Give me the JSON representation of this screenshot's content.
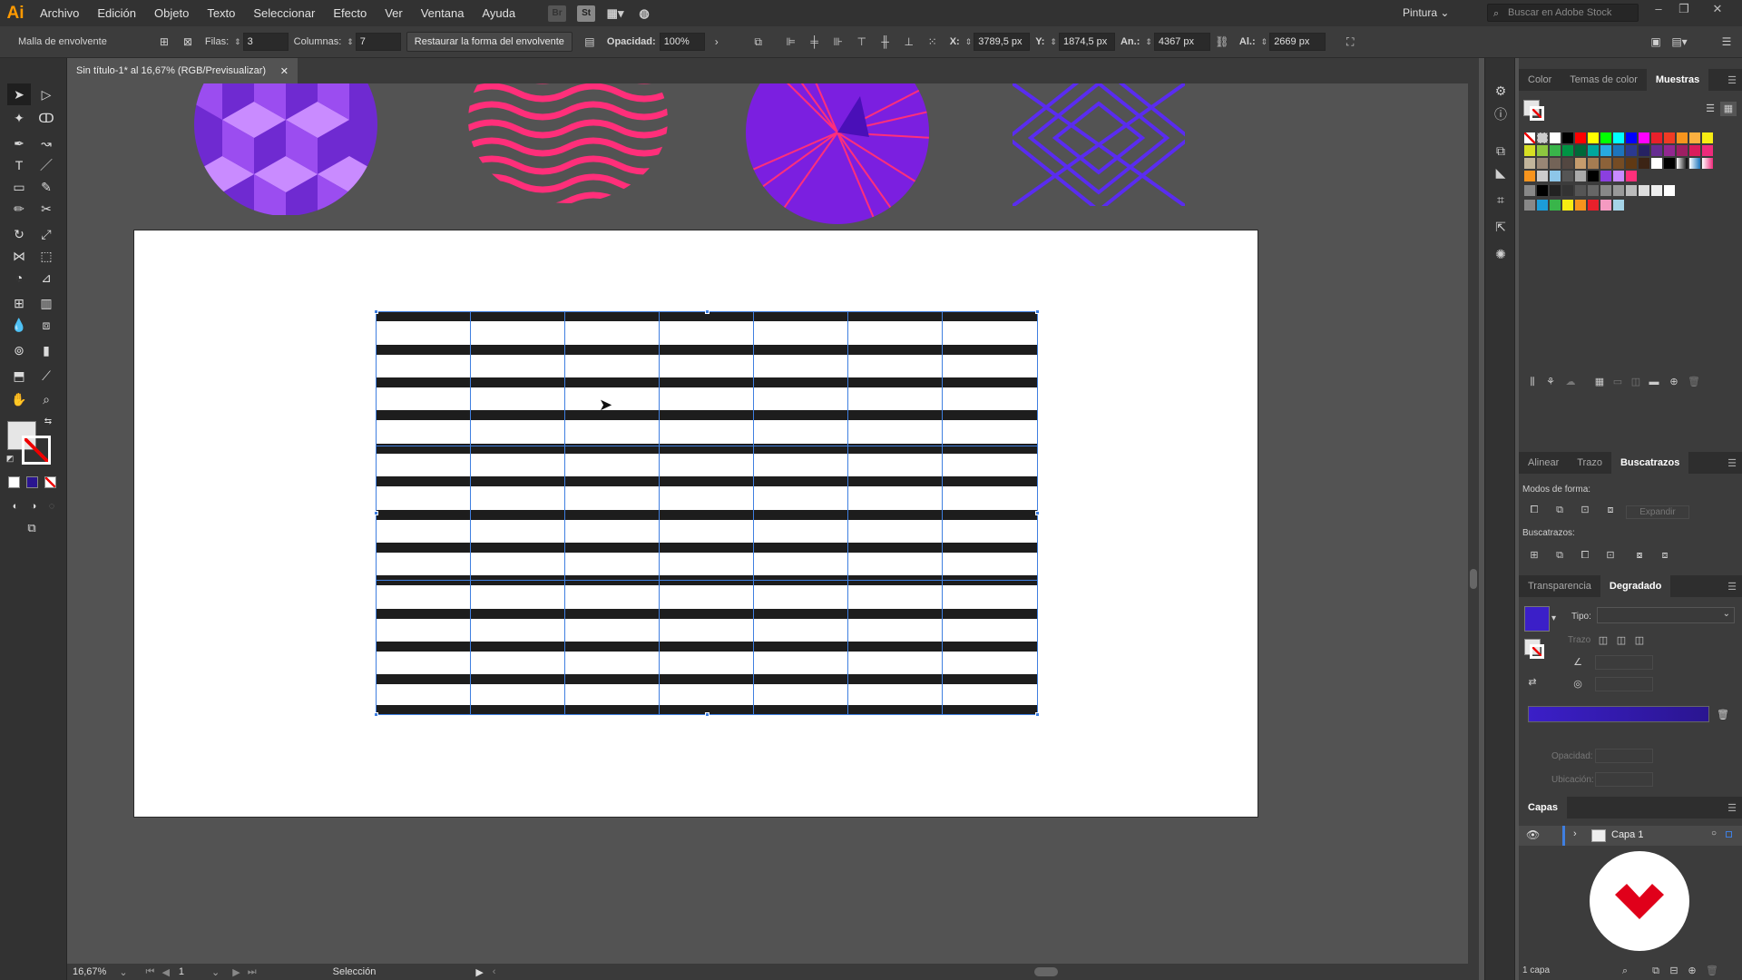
{
  "app": {
    "logo": "Ai",
    "workspace": "Pintura",
    "stock_placeholder": "Buscar en Adobe Stock"
  },
  "menus": [
    "Archivo",
    "Edición",
    "Objeto",
    "Texto",
    "Seleccionar",
    "Efecto",
    "Ver",
    "Ventana",
    "Ayuda"
  ],
  "control": {
    "object_type": "Malla de envolvente",
    "rows_label": "Filas:",
    "rows_value": "3",
    "cols_label": "Columnas:",
    "cols_value": "7",
    "restore_label": "Restaurar la forma del envolvente",
    "opacity_label": "Opacidad:",
    "opacity_value": "100%",
    "x_label": "X:",
    "x_value": "3789,5 px",
    "y_label": "Y:",
    "y_value": "1874,5 px",
    "w_label": "An.:",
    "w_value": "4367 px",
    "h_label": "Al.:",
    "h_value": "2669 px"
  },
  "document": {
    "tab_title": "Sin título-1* al 16,67% (RGB/Previsualizar)"
  },
  "status": {
    "zoom": "16,67%",
    "page": "1",
    "tool": "Selección"
  },
  "panels": {
    "top_tabs": [
      "Color",
      "Temas de color",
      "Muestras"
    ],
    "mid_tabs": [
      "Alinear",
      "Trazo",
      "Buscatrazos"
    ],
    "shape_modes": "Modos de forma:",
    "expand": "Expandir",
    "pathfinders": "Buscatrazos:",
    "grad_tabs": [
      "Transparencia",
      "Degradado"
    ],
    "type_label": "Tipo:",
    "stroke_label": "Trazo",
    "opacity_label": "Opacidad:",
    "location_label": "Ubicación:",
    "layers_tab": "Capas",
    "layer_name": "Capa 1",
    "layers_count": "1 capa"
  },
  "colors": {
    "accent_selection": "#3f7fe0",
    "gradient_start": "#3b1fc8",
    "gradient_end": "#2a1590",
    "pattern_purple": "#8b3fe0",
    "pattern_pink": "#ff2f7a",
    "brand_red": "#e0001a"
  }
}
